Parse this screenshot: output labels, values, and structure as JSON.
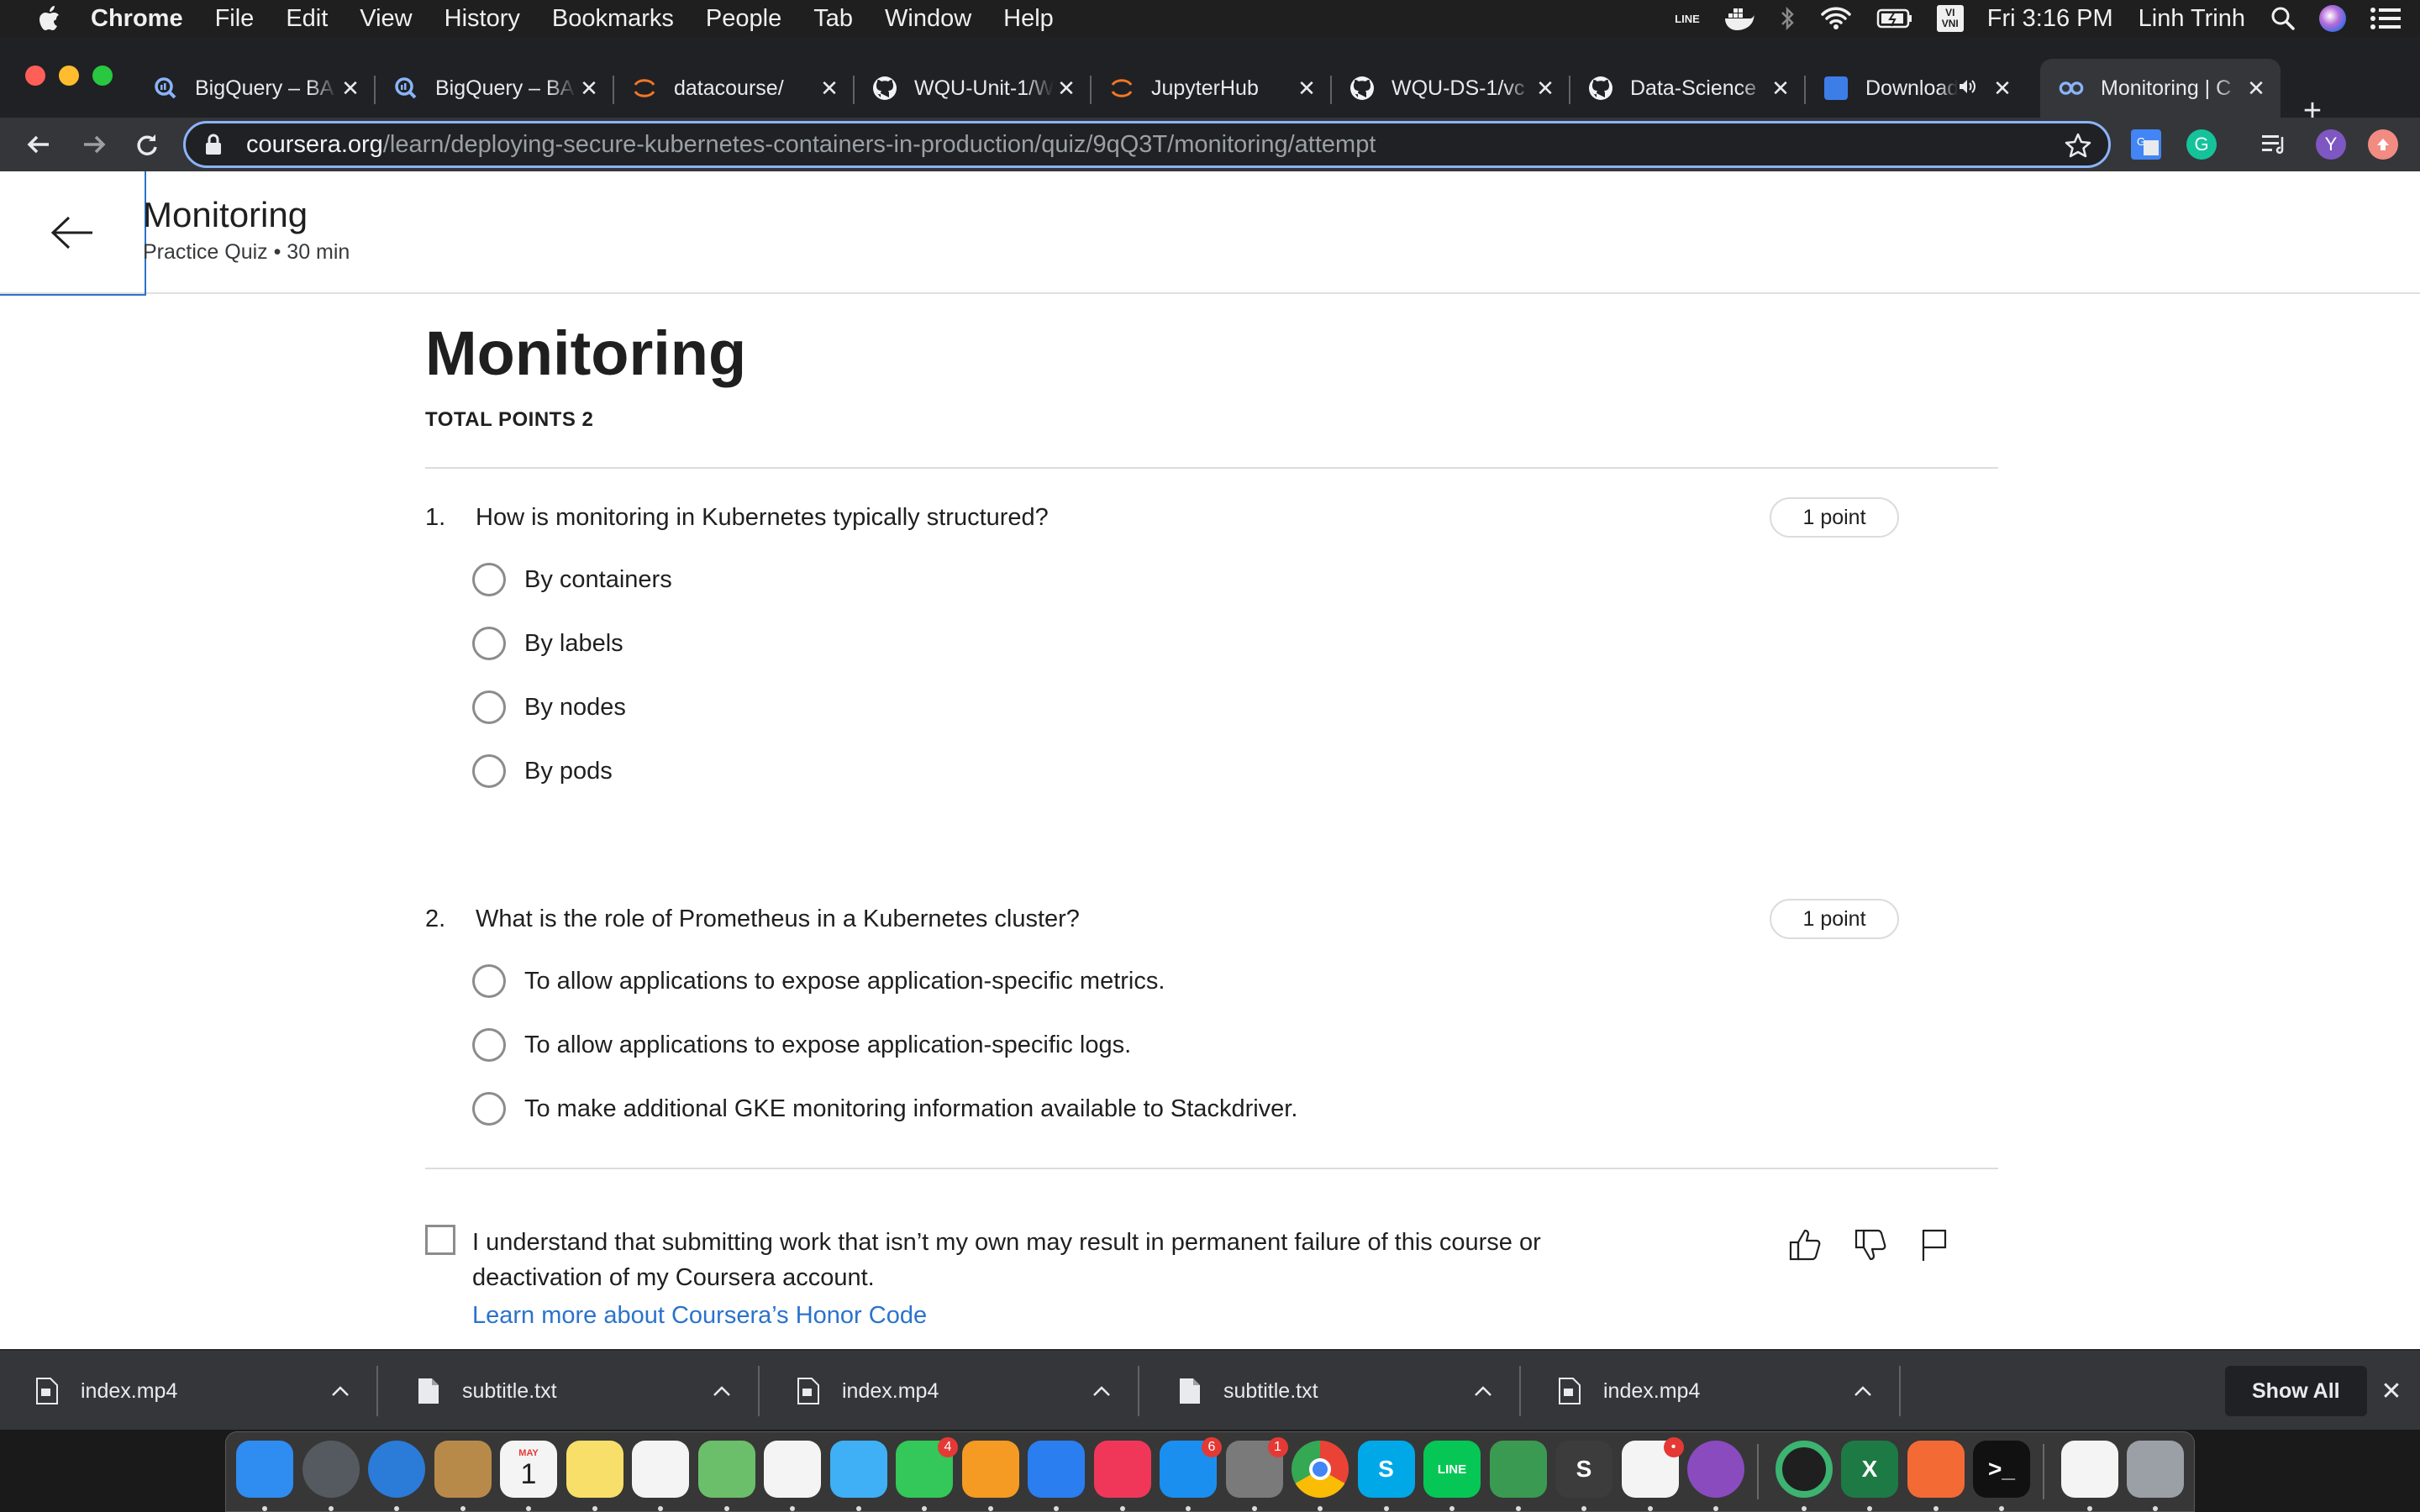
{
  "menubar": {
    "app_name": "Chrome",
    "menus": [
      "File",
      "Edit",
      "View",
      "History",
      "Bookmarks",
      "People",
      "Tab",
      "Window",
      "Help"
    ],
    "clock": "Fri 3:16 PM",
    "user": "Linh Trinh",
    "status_icons": [
      "line-icon",
      "docker-icon",
      "bluetooth-icon",
      "wifi-icon",
      "battery-icon",
      "input-source-icon",
      "search-icon",
      "siri-icon",
      "notification-center-icon"
    ],
    "input_source_label": "VI\nVNI",
    "line_label": "LINE"
  },
  "tabs": [
    {
      "title": "BigQuery – BA",
      "icon": "bigquery-icon",
      "active": false
    },
    {
      "title": "BigQuery – BA",
      "icon": "bigquery-icon",
      "active": false
    },
    {
      "title": "datacourse/",
      "icon": "jupyter-icon",
      "active": false
    },
    {
      "title": "WQU-Unit-1/W",
      "icon": "github-icon",
      "active": false
    },
    {
      "title": "JupyterHub",
      "icon": "jupyter-icon",
      "active": false
    },
    {
      "title": "WQU-DS-1/vc",
      "icon": "github-icon",
      "active": false
    },
    {
      "title": "Data-Science",
      "icon": "github-icon",
      "active": false
    },
    {
      "title": "Download",
      "icon": "download-site-icon",
      "active": false,
      "audio": true
    },
    {
      "title": "Monitoring | C",
      "icon": "coursera-icon",
      "active": true
    }
  ],
  "address_bar": {
    "domain": "coursera.org",
    "path": "/learn/deploying-secure-kubernetes-containers-in-production/quiz/9qQ3T/monitoring/attempt"
  },
  "extensions": {
    "profile_initial": "Y"
  },
  "header": {
    "title": "Monitoring",
    "subtitle": "Practice Quiz • 30 min"
  },
  "quiz": {
    "title": "Monitoring",
    "total_points": "TOTAL POINTS 2",
    "questions": [
      {
        "number": "1.",
        "text": "How is monitoring in Kubernetes typically structured?",
        "points": "1 point",
        "options": [
          "By containers",
          "By labels",
          "By nodes",
          "By pods"
        ]
      },
      {
        "number": "2.",
        "text": "What is the role of Prometheus in a Kubernetes cluster?",
        "points": "1 point",
        "options": [
          "To allow applications to expose application-specific metrics.",
          "To allow applications to expose application-specific logs.",
          "To make additional GKE monitoring information available to Stackdriver."
        ]
      }
    ],
    "honor_code": {
      "text": "I understand that submitting work that isn’t my own may result in permanent failure of this course or deactivation of my Coursera account.",
      "link": "Learn more about Coursera’s Honor Code",
      "checked": false
    }
  },
  "downloads": {
    "items": [
      "index.mp4",
      "subtitle.txt",
      "index.mp4",
      "subtitle.txt",
      "index.mp4"
    ],
    "show_all": "Show All"
  },
  "dock": {
    "apps": [
      {
        "name": "finder",
        "color": "#2f8cf0"
      },
      {
        "name": "launchpad",
        "color": "#555a60"
      },
      {
        "name": "safari",
        "color": "#2b7bd8"
      },
      {
        "name": "contacts",
        "color": "#b88a4a"
      },
      {
        "name": "calendar",
        "color": "#f4f4f4",
        "label": "1",
        "month": "MAY"
      },
      {
        "name": "notes",
        "color": "#f7df6a"
      },
      {
        "name": "reminders",
        "color": "#f4f4f4"
      },
      {
        "name": "maps",
        "color": "#6cbf6a"
      },
      {
        "name": "photos",
        "color": "#f4f4f4"
      },
      {
        "name": "messages",
        "color": "#3fb0f5"
      },
      {
        "name": "facetime",
        "color": "#34c759",
        "badge": "4"
      },
      {
        "name": "pages",
        "color": "#f59a23"
      },
      {
        "name": "keynote",
        "color": "#2a7ef0"
      },
      {
        "name": "music",
        "color": "#f0375a"
      },
      {
        "name": "app-store",
        "color": "#1b8ff0",
        "badge": "6"
      },
      {
        "name": "system-preferences",
        "color": "#7a7a7a",
        "badge": "1"
      },
      {
        "name": "chrome",
        "color": "#f4f4f4"
      },
      {
        "name": "skype",
        "color": "#00a8e8",
        "label": "S"
      },
      {
        "name": "line",
        "color": "#06c755",
        "label": "LINE"
      },
      {
        "name": "turtle",
        "color": "#3a9a52"
      },
      {
        "name": "sublime-text",
        "color": "#3c3c3c",
        "label": "S"
      },
      {
        "name": "slack",
        "color": "#f4f4f4",
        "badge": "•"
      },
      {
        "name": "github-desktop",
        "color": "#8a4bbf"
      },
      {
        "name": "activity-ring",
        "color": "#1f1f1f"
      },
      {
        "name": "excel",
        "color": "#1d7a45",
        "label": "X"
      },
      {
        "name": "postman",
        "color": "#f46a35"
      },
      {
        "name": "terminal",
        "color": "#111111",
        "label": ">_"
      },
      {
        "name": "document",
        "color": "#f4f4f4"
      },
      {
        "name": "trash",
        "color": "#9aa0a6"
      }
    ]
  }
}
